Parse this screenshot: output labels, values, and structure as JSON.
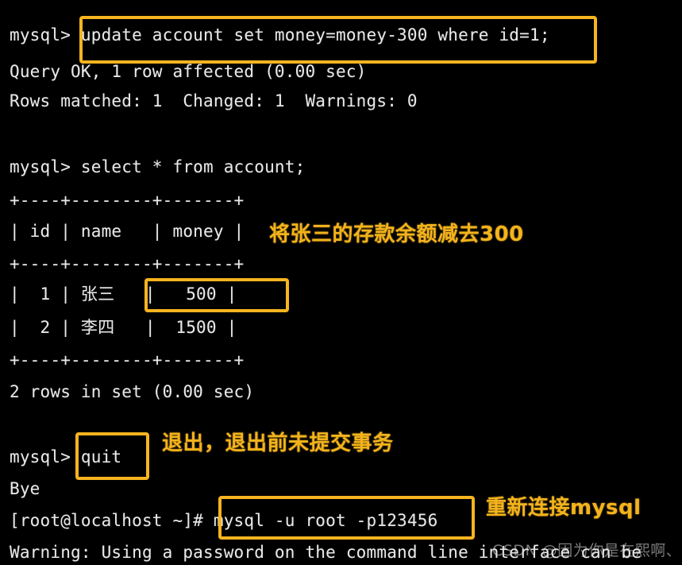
{
  "terminal": {
    "background_color": "#000000",
    "text_color": "#e8e8e8",
    "accent_color": "#f6b41f",
    "lines": [
      {
        "id": "l1",
        "text": "mysql> update account set money=money-300 where id=1;"
      },
      {
        "id": "l2",
        "text": "Query OK, 1 row affected (0.00 sec)"
      },
      {
        "id": "l3",
        "text": "Rows matched: 1  Changed: 1  Warnings: 0"
      },
      {
        "id": "l4",
        "text": "mysql> select * from account;"
      },
      {
        "id": "l5",
        "text": "+----+--------+-------+"
      },
      {
        "id": "l6",
        "text": "| id | name   | money |"
      },
      {
        "id": "l7",
        "text": "+----+--------+-------+"
      },
      {
        "id": "l8",
        "text": "|  1 | 张三   |   500 |"
      },
      {
        "id": "l9",
        "text": "|  2 | 李四   |  1500 |"
      },
      {
        "id": "l10",
        "text": "+----+--------+-------+"
      },
      {
        "id": "l11",
        "text": "2 rows in set (0.00 sec)"
      },
      {
        "id": "l12",
        "text": "mysql> quit"
      },
      {
        "id": "l13",
        "text": "Bye"
      },
      {
        "id": "l14",
        "text": "[root@localhost ~]# mysql -u root -p123456"
      },
      {
        "id": "l15",
        "text": "Warning: Using a password on the command line interface can be"
      }
    ],
    "prompt_mysql": "mysql>",
    "prompt_shell": "[root@localhost ~]#",
    "commands": {
      "update_statement": "update account set money=money-300 where id=1;",
      "select_statement": "select * from account;",
      "quit_command": "quit",
      "login_command": "mysql -u root -p123456"
    },
    "query_results": {
      "update_result": "Query OK, 1 row affected (0.00 sec)",
      "update_detail": "Rows matched: 1  Changed: 1  Warnings: 0",
      "select_footer": "2 rows in set (0.00 sec)",
      "quit_result": "Bye",
      "warning": "Warning: Using a password on the command line interface can be"
    }
  },
  "table": {
    "type": "table",
    "columns": [
      "id",
      "name",
      "money"
    ],
    "rows": [
      {
        "id": "1",
        "name": "张三",
        "money": "500"
      },
      {
        "id": "2",
        "name": "李四",
        "money": "1500"
      }
    ],
    "row_count_text": "2 rows in set (0.00 sec)",
    "separator": "+----+--------+-------+",
    "header_row": "| id | name   | money |",
    "row_1": "|  1 | 张三   |   500 |",
    "row_2": "|  2 | 李四   |  1500 |"
  },
  "annotations": [
    {
      "id": "a1",
      "text": "将张三的存款余额减去300"
    },
    {
      "id": "a2",
      "text": "退出，退出前未提交事务"
    },
    {
      "id": "a3",
      "text": "重新连接mysql"
    }
  ],
  "highlights": [
    {
      "id": "h1",
      "target": "update account set money=money-300 where id=1;"
    },
    {
      "id": "h2",
      "target": "|   500 |"
    },
    {
      "id": "h3",
      "target": "quit"
    },
    {
      "id": "h4",
      "target": "mysql -u root -p123456"
    }
  ],
  "watermark": {
    "text": "CSDN @因为你是在熙啊、"
  }
}
